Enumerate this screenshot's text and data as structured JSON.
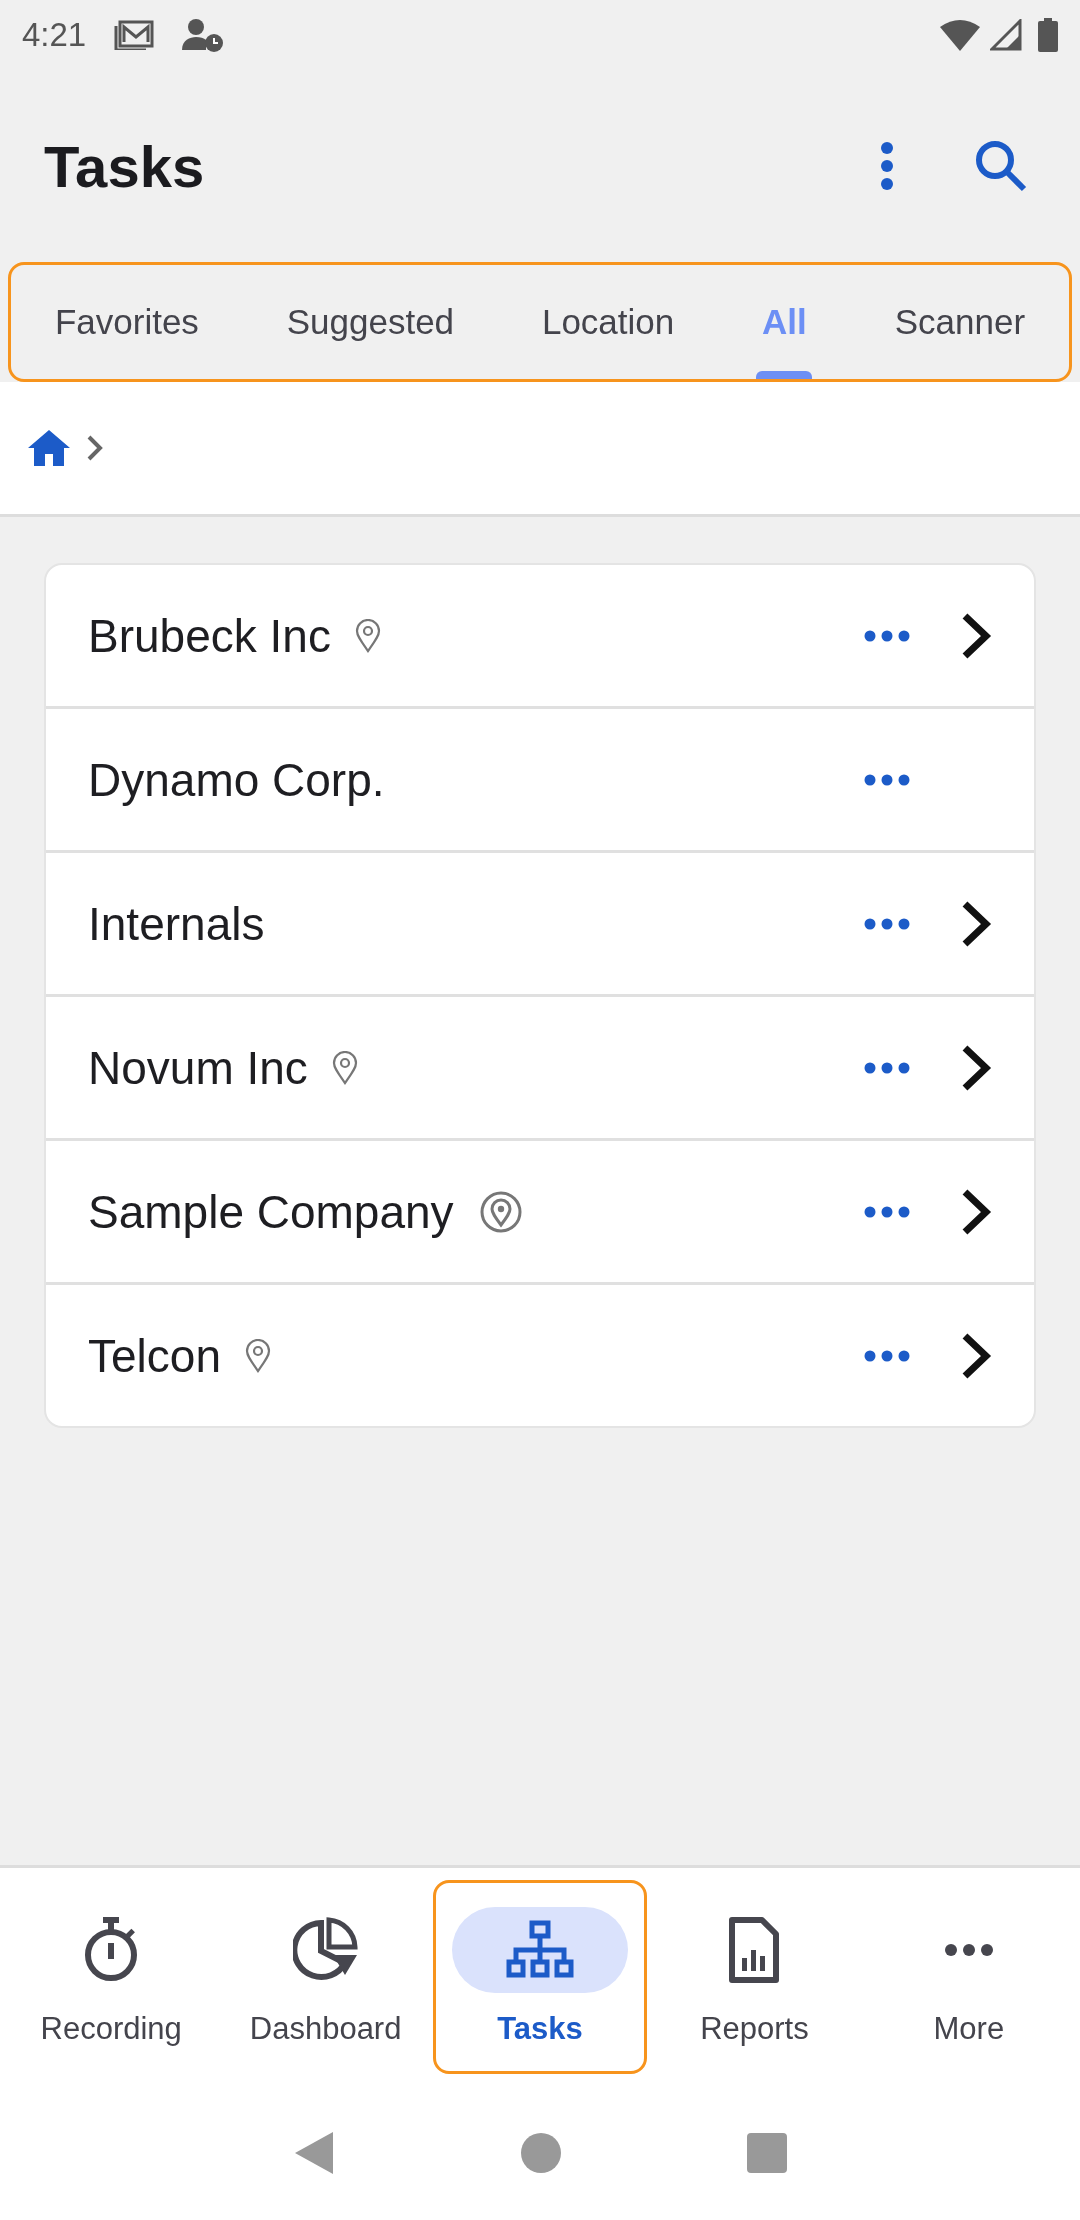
{
  "status_bar": {
    "time": "4:21"
  },
  "header": {
    "title": "Tasks"
  },
  "tab_bar": {
    "focused": true,
    "tabs": [
      {
        "label": "Favorites",
        "selected": false
      },
      {
        "label": "Suggested",
        "selected": false
      },
      {
        "label": "Location",
        "selected": false
      },
      {
        "label": "All",
        "selected": true
      },
      {
        "label": "Scanner",
        "selected": false
      }
    ]
  },
  "list": [
    {
      "name": "Brubeck Inc",
      "kind": "pin",
      "has_children": true
    },
    {
      "name": "Dynamo Corp.",
      "has_children": false
    },
    {
      "name": "Internals",
      "has_children": true
    },
    {
      "name": "Novum Inc",
      "kind": "pin",
      "has_children": true
    },
    {
      "name": "Sample Company",
      "kind": "ring_pin",
      "has_children": true
    },
    {
      "name": "Telcon",
      "kind": "pin",
      "has_children": true
    }
  ],
  "bottom_nav": [
    {
      "label": "Recording",
      "kind": "stopwatch",
      "selected": false,
      "focused": false
    },
    {
      "label": "Dashboard",
      "kind": "pie",
      "selected": false,
      "focused": false
    },
    {
      "label": "Tasks",
      "kind": "tree",
      "selected": true,
      "focused": true
    },
    {
      "label": "Reports",
      "kind": "report",
      "selected": false,
      "focused": false
    },
    {
      "label": "More",
      "kind": "more",
      "selected": false,
      "focused": false
    }
  ]
}
